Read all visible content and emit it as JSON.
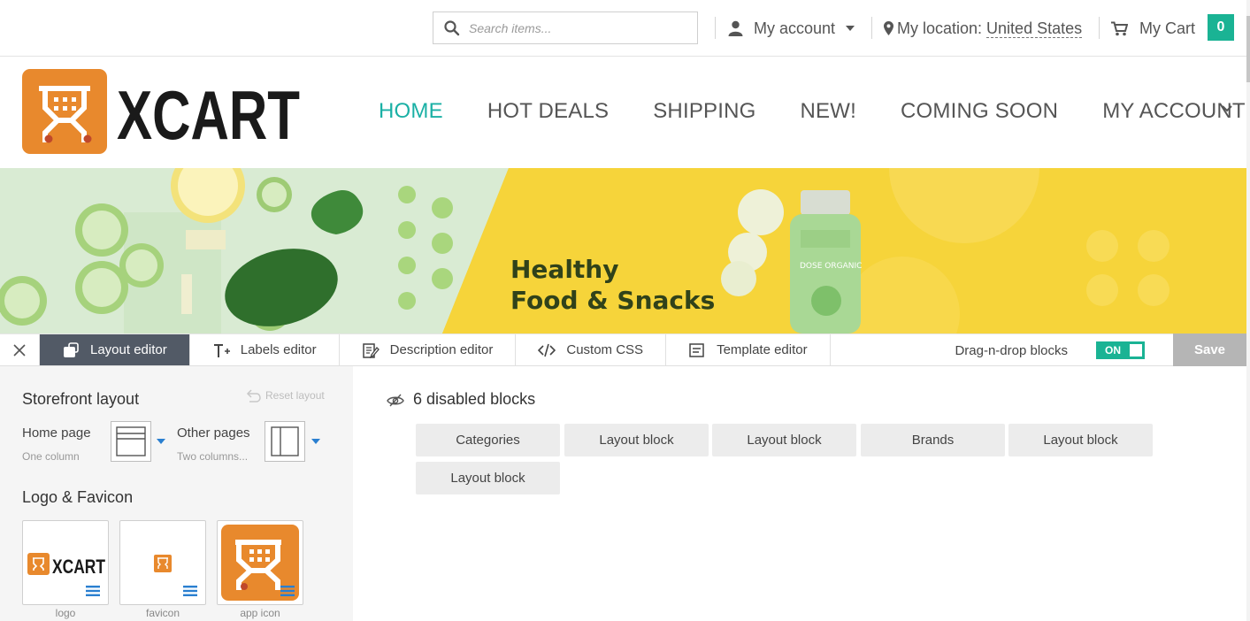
{
  "topbar": {
    "search_placeholder": "Search items...",
    "account_label": "My account",
    "location_prefix": "My location:",
    "location_value": "United States",
    "cart_label": "My Cart",
    "cart_count": "0"
  },
  "header": {
    "logo_text": "XCART",
    "nav": [
      {
        "label": "HOME",
        "active": true
      },
      {
        "label": "HOT DEALS",
        "active": false
      },
      {
        "label": "SHIPPING",
        "active": false
      },
      {
        "label": "NEW!",
        "active": false
      },
      {
        "label": "COMING SOON",
        "active": false
      },
      {
        "label": "MY ACCOUNT",
        "active": false
      }
    ]
  },
  "banner": {
    "line1": "Healthy",
    "line2": "Food & Snacks",
    "bottle_text": "DOSE ORGANIC"
  },
  "toolbar": {
    "tabs": [
      {
        "label": "Layout editor",
        "icon": "layout-icon",
        "active": true
      },
      {
        "label": "Labels editor",
        "icon": "text-icon",
        "active": false
      },
      {
        "label": "Description editor",
        "icon": "edit-icon",
        "active": false
      },
      {
        "label": "Custom CSS",
        "icon": "code-icon",
        "active": false
      },
      {
        "label": "Template editor",
        "icon": "template-icon",
        "active": false
      }
    ],
    "dnd_label": "Drag-n-drop blocks",
    "dnd_state": "ON",
    "save_label": "Save"
  },
  "left": {
    "storefront_title": "Storefront layout",
    "reset_label": "Reset layout",
    "home_label": "Home page",
    "home_sub": "One column",
    "other_label": "Other pages",
    "other_sub": "Two columns...",
    "logo_title": "Logo & Favicon",
    "thumbs": [
      "logo",
      "favicon",
      "app icon"
    ]
  },
  "content": {
    "disabled_title": "6 disabled blocks",
    "blocks": [
      "Categories",
      "Layout block",
      "Layout block",
      "Brands",
      "Layout block",
      "Layout block"
    ]
  },
  "colors": {
    "accent": "#1ab394",
    "nav_active": "#1ab0a5",
    "brand_orange": "#e8892d",
    "toolbar_active": "#525a66"
  }
}
